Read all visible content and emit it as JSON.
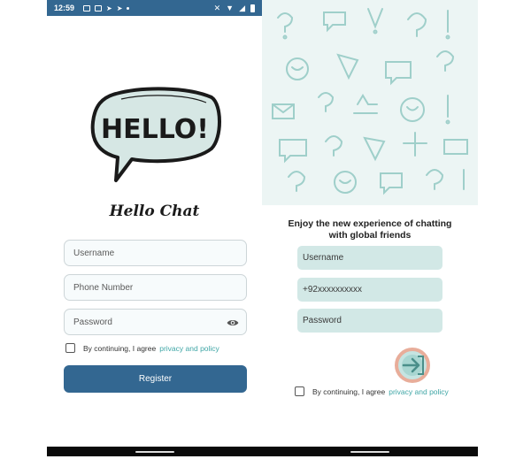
{
  "status_bar": {
    "time": "12:59"
  },
  "register_screen": {
    "logo_text": "HELLO!",
    "title": "Hello Chat",
    "username_placeholder": "Username",
    "phone_placeholder": "Phone Number",
    "password_placeholder": "Password",
    "agree_text": "By continuing, I agree",
    "agree_link": "privacy and policy",
    "register_label": "Register"
  },
  "login_screen": {
    "tagline_line1": "Enjoy the new experience of chatting",
    "tagline_line2": "with global friends",
    "username_placeholder": "Username",
    "phone_value": "+92xxxxxxxxxx",
    "password_placeholder": "Password",
    "agree_text": "By continuing, I agree",
    "agree_link": "privacy and policy"
  },
  "colors": {
    "primary": "#336791",
    "accent_link": "#3fa6a6",
    "field_teal": "#d2e8e6",
    "submit_ring": "#e8ad9a"
  }
}
